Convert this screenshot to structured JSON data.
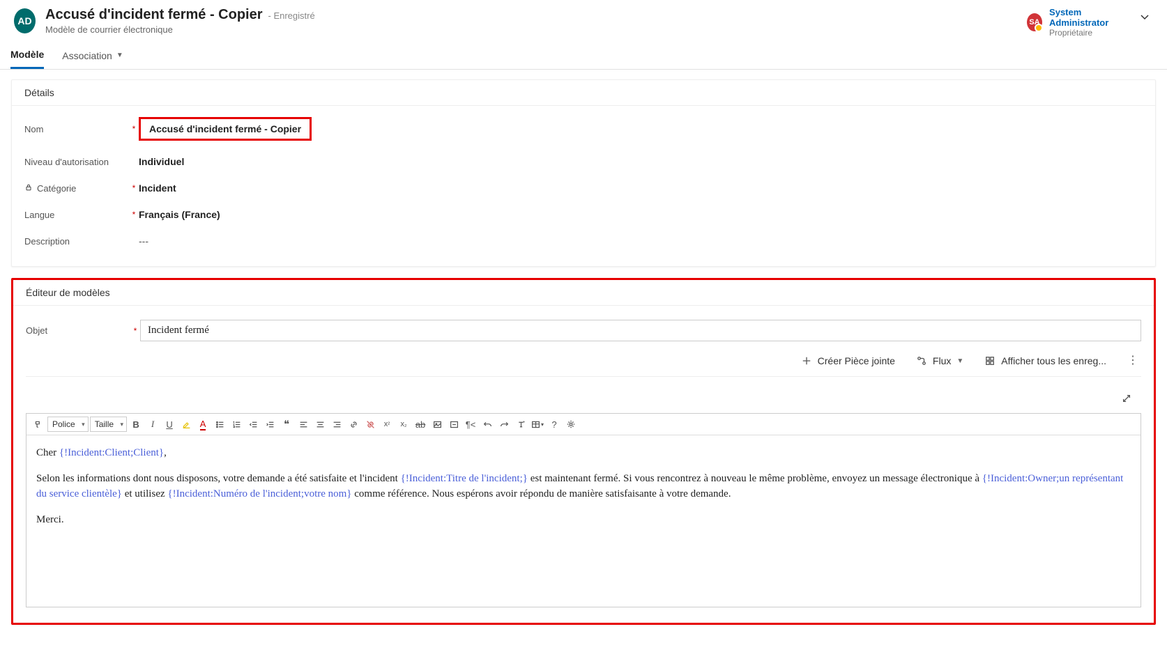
{
  "header": {
    "app_avatar": "AD",
    "title": "Accusé d'incident fermé - Copier",
    "saved_suffix": "- Enregistré",
    "subtitle": "Modèle de courrier électronique",
    "owner_avatar": "SA",
    "owner_name": "System Administrator",
    "owner_role": "Propriétaire"
  },
  "tabs": {
    "tab1": "Modèle",
    "tab2": "Association"
  },
  "details": {
    "section_title": "Détails",
    "name_label": "Nom",
    "name_value": "Accusé d'incident fermé - Copier",
    "auth_label": "Niveau d'autorisation",
    "auth_value": "Individuel",
    "category_label": "Catégorie",
    "category_value": "Incident",
    "lang_label": "Langue",
    "lang_value": "Français (France)",
    "desc_label": "Description",
    "desc_value": "---"
  },
  "editor": {
    "section_title": "Éditeur de modèles",
    "subject_label": "Objet",
    "subject_value": "Incident fermé",
    "actions": {
      "attach": "Créer Pièce jointe",
      "flow": "Flux",
      "showall": "Afficher tous les enreg..."
    },
    "toolbar": {
      "font": "Police",
      "size": "Taille"
    },
    "body": {
      "line1_a": "Cher ",
      "line1_token": "{!Incident:Client;Client}",
      "line1_b": ",",
      "line2_a": "Selon les informations dont nous disposons, votre demande a été satisfaite et l'incident ",
      "line2_t1": "{!Incident:Titre de l'incident;}",
      "line2_b": " est maintenant fermé. Si vous rencontrez à nouveau le même problème, envoyez un message électronique à ",
      "line2_t2": "{!Incident:Owner;un représentant du service clientèle}",
      "line2_c": " et utilisez ",
      "line2_t3": "{!Incident:Numéro de l'incident;votre nom}",
      "line2_d": " comme référence. Nous espérons avoir répondu de manière satisfaisante à votre demande.",
      "line3": "Merci."
    }
  }
}
